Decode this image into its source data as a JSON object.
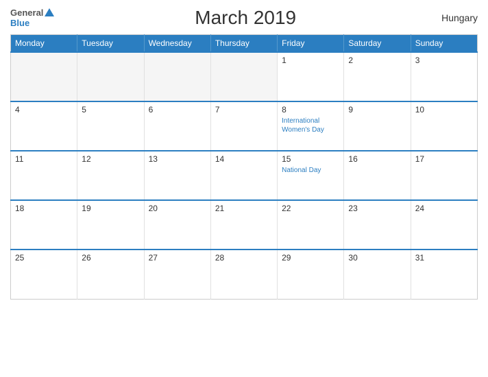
{
  "header": {
    "logo_general": "General",
    "logo_blue": "Blue",
    "title": "March 2019",
    "country": "Hungary"
  },
  "calendar": {
    "days_of_week": [
      "Monday",
      "Tuesday",
      "Wednesday",
      "Thursday",
      "Friday",
      "Saturday",
      "Sunday"
    ],
    "weeks": [
      [
        {
          "day": "",
          "event": "",
          "empty": true
        },
        {
          "day": "",
          "event": "",
          "empty": true
        },
        {
          "day": "",
          "event": "",
          "empty": true
        },
        {
          "day": "",
          "event": "",
          "empty": true
        },
        {
          "day": "1",
          "event": "",
          "empty": false
        },
        {
          "day": "2",
          "event": "",
          "empty": false
        },
        {
          "day": "3",
          "event": "",
          "empty": false
        }
      ],
      [
        {
          "day": "4",
          "event": "",
          "empty": false
        },
        {
          "day": "5",
          "event": "",
          "empty": false
        },
        {
          "day": "6",
          "event": "",
          "empty": false
        },
        {
          "day": "7",
          "event": "",
          "empty": false
        },
        {
          "day": "8",
          "event": "International Women's Day",
          "empty": false
        },
        {
          "day": "9",
          "event": "",
          "empty": false
        },
        {
          "day": "10",
          "event": "",
          "empty": false
        }
      ],
      [
        {
          "day": "11",
          "event": "",
          "empty": false
        },
        {
          "day": "12",
          "event": "",
          "empty": false
        },
        {
          "day": "13",
          "event": "",
          "empty": false
        },
        {
          "day": "14",
          "event": "",
          "empty": false
        },
        {
          "day": "15",
          "event": "National Day",
          "empty": false
        },
        {
          "day": "16",
          "event": "",
          "empty": false
        },
        {
          "day": "17",
          "event": "",
          "empty": false
        }
      ],
      [
        {
          "day": "18",
          "event": "",
          "empty": false
        },
        {
          "day": "19",
          "event": "",
          "empty": false
        },
        {
          "day": "20",
          "event": "",
          "empty": false
        },
        {
          "day": "21",
          "event": "",
          "empty": false
        },
        {
          "day": "22",
          "event": "",
          "empty": false
        },
        {
          "day": "23",
          "event": "",
          "empty": false
        },
        {
          "day": "24",
          "event": "",
          "empty": false
        }
      ],
      [
        {
          "day": "25",
          "event": "",
          "empty": false
        },
        {
          "day": "26",
          "event": "",
          "empty": false
        },
        {
          "day": "27",
          "event": "",
          "empty": false
        },
        {
          "day": "28",
          "event": "",
          "empty": false
        },
        {
          "day": "29",
          "event": "",
          "empty": false
        },
        {
          "day": "30",
          "event": "",
          "empty": false
        },
        {
          "day": "31",
          "event": "",
          "empty": false
        }
      ]
    ]
  }
}
